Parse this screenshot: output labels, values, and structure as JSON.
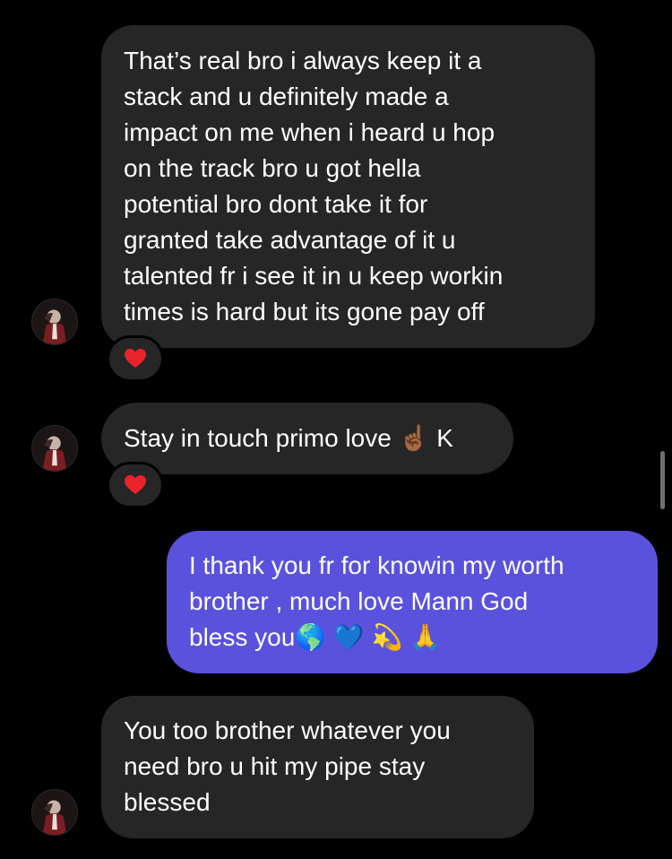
{
  "messages": [
    {
      "direction": "incoming",
      "text": "That’s real bro i always keep it a\nstack and u definitely made a\nimpact on me when i heard u hop\non the track bro u got hella\npotential bro dont take it for\ngranted take advantage of it  u\ntalented fr i see it in u keep workin\ntimes is hard but its gone pay off",
      "reaction": "❤️",
      "reaction_icon": "heart-icon"
    },
    {
      "direction": "incoming",
      "text": "Stay in touch primo love ☝🏾 K",
      "reaction": "❤️",
      "reaction_icon": "heart-icon"
    },
    {
      "direction": "outgoing",
      "text": "I thank you fr for knowin my worth\nbrother , much love Mann God\nbless you🌎 💙 💫 🙏"
    },
    {
      "direction": "incoming",
      "text": "You too brother whatever you\nneed bro u hit my pipe stay\nblessed"
    }
  ],
  "colors": {
    "background": "#000000",
    "incoming_bubble": "#262626",
    "outgoing_bubble": "#5a52dd",
    "text": "#ffffff",
    "heart": "#e8232b"
  },
  "icons": {
    "avatar": "profile-avatar",
    "reaction": "heart-icon"
  }
}
